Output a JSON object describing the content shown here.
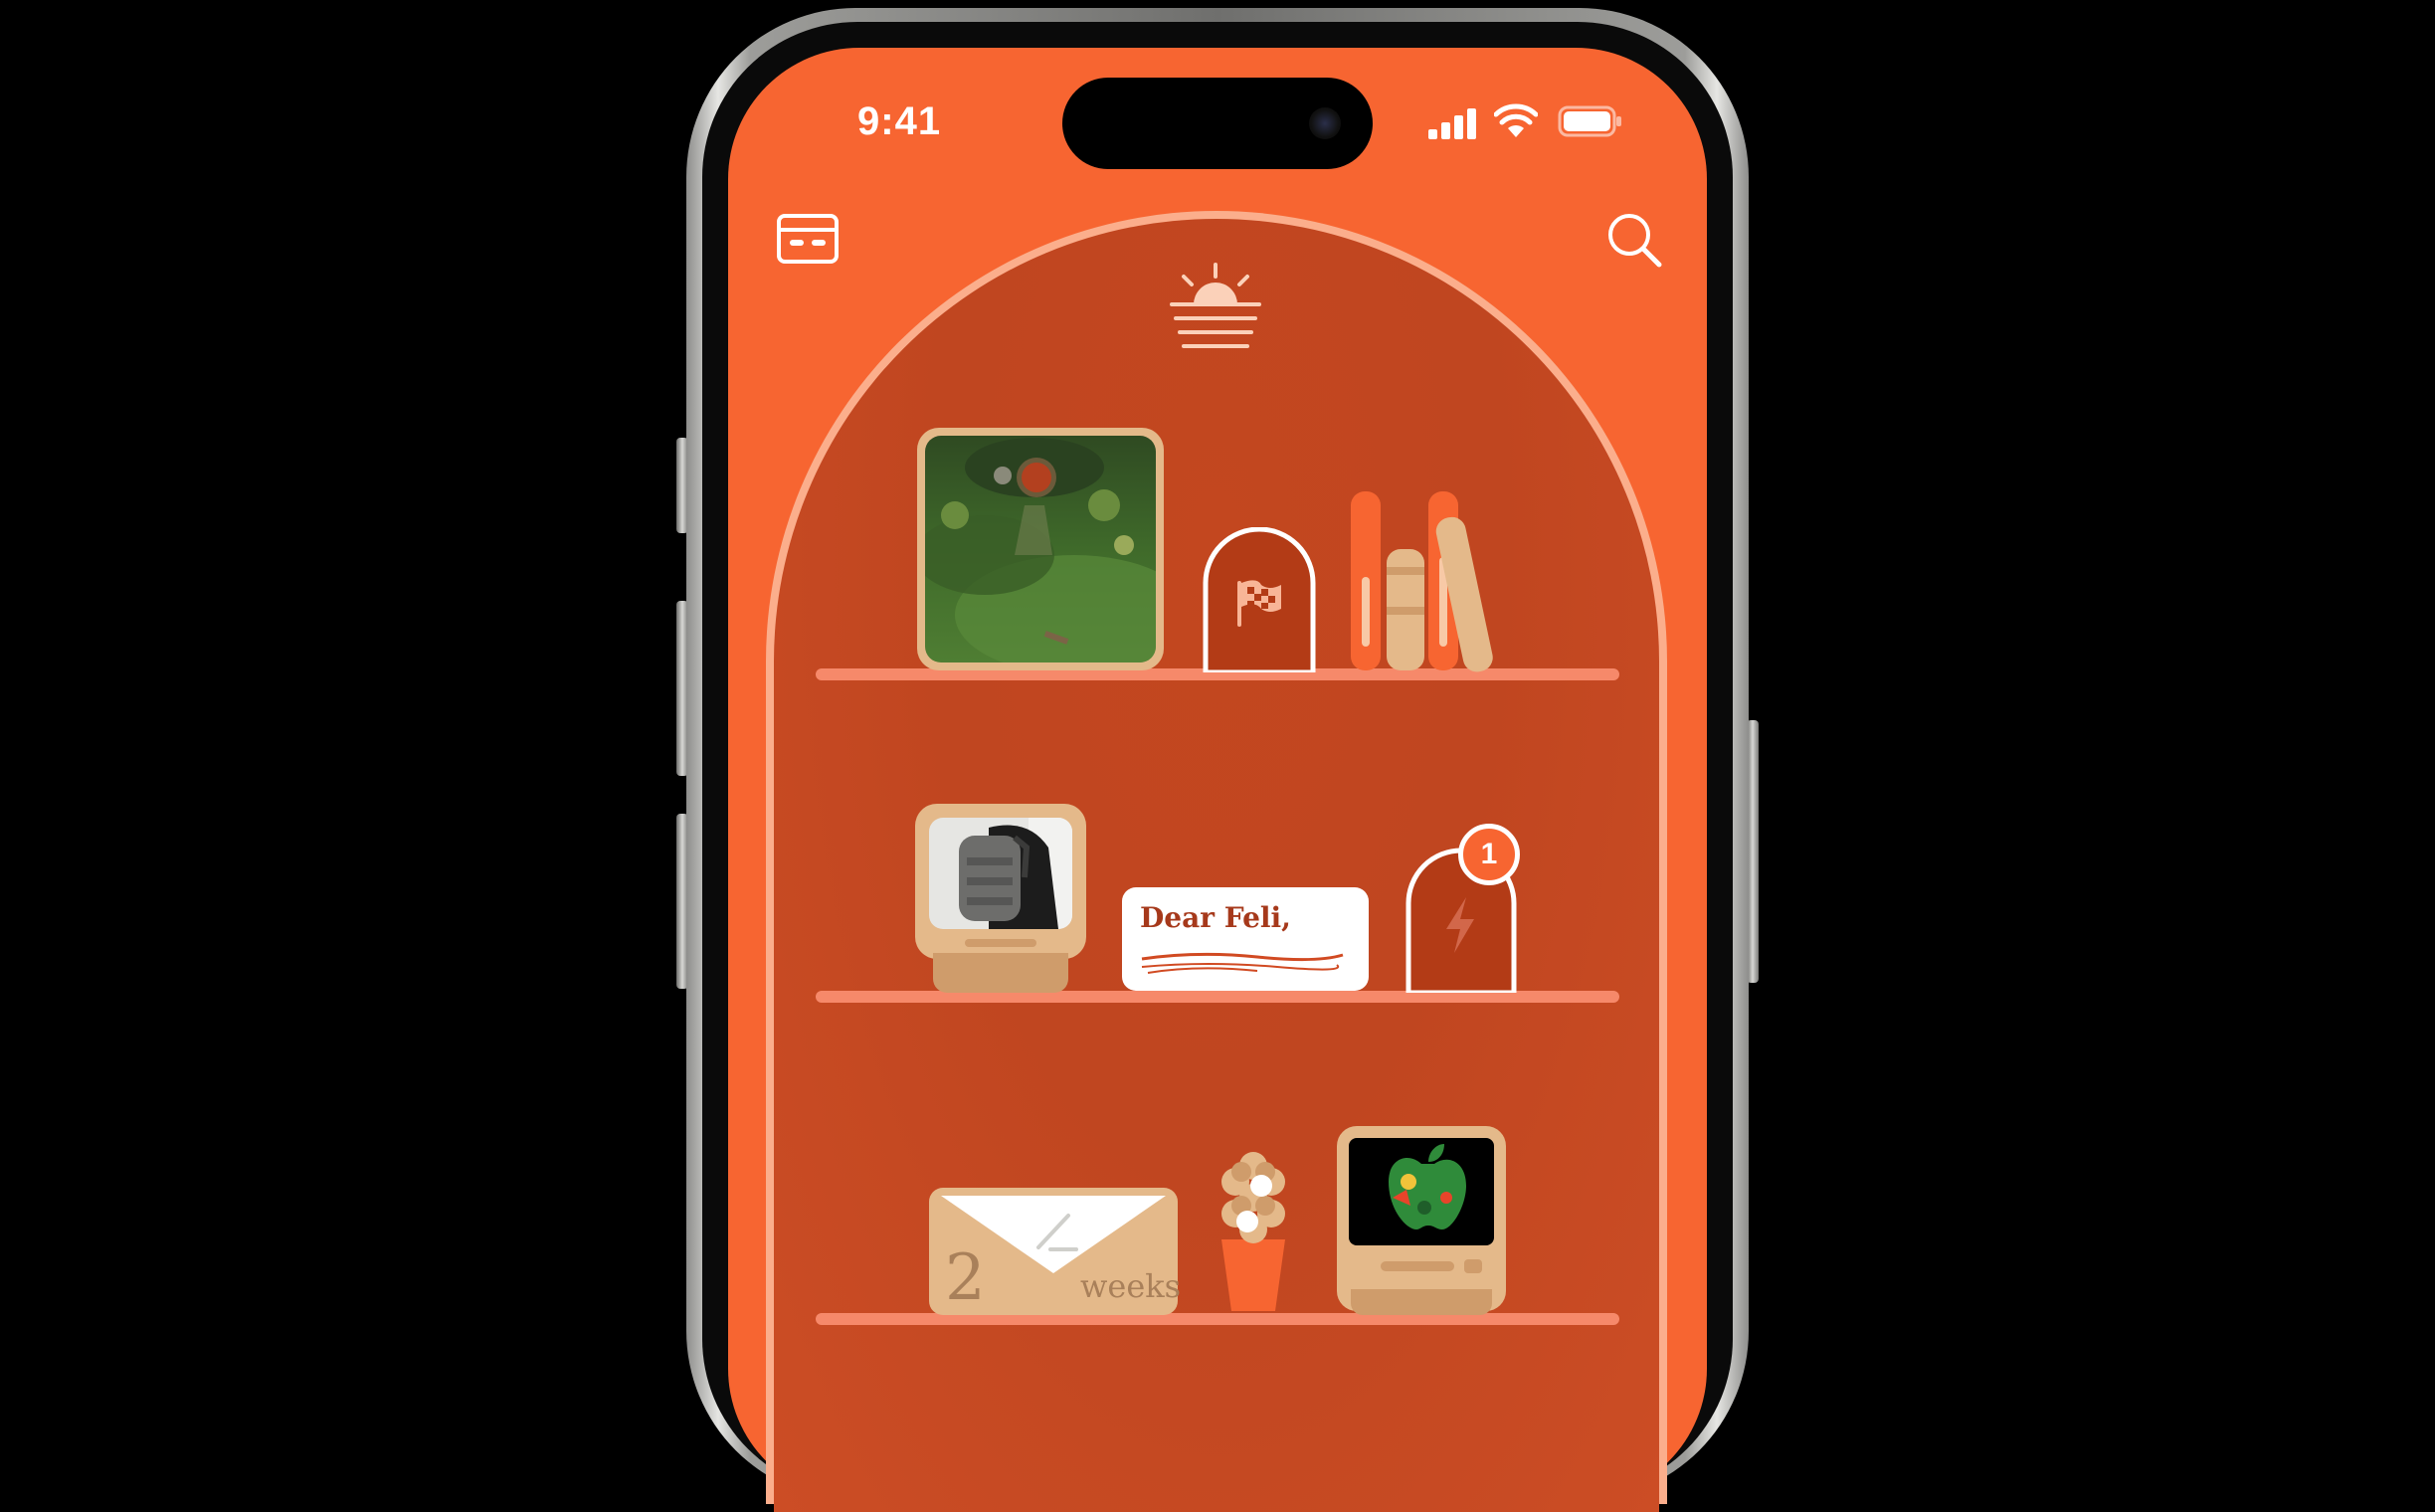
{
  "status_bar": {
    "time": "9:41",
    "signal_icon": "cellular-signal-icon",
    "wifi_icon": "wifi-icon",
    "battery_icon": "battery-icon"
  },
  "toolbar": {
    "left_icon": "id-card-icon",
    "right_icon": "search-icon",
    "header_icon": "sunrise-icon"
  },
  "shelf_items": {
    "note": {
      "text": "Dear Feli,"
    },
    "badge": {
      "count": "1"
    },
    "countdown": {
      "number": "2",
      "unit": "weeks"
    }
  },
  "colors": {
    "screen_bg": "#f76531",
    "arch_bg": "#c04620",
    "arch_border": "#fbae8c",
    "shelf": "#f6896a",
    "tan": "#e4b98a",
    "accent_red": "#b33b16"
  }
}
